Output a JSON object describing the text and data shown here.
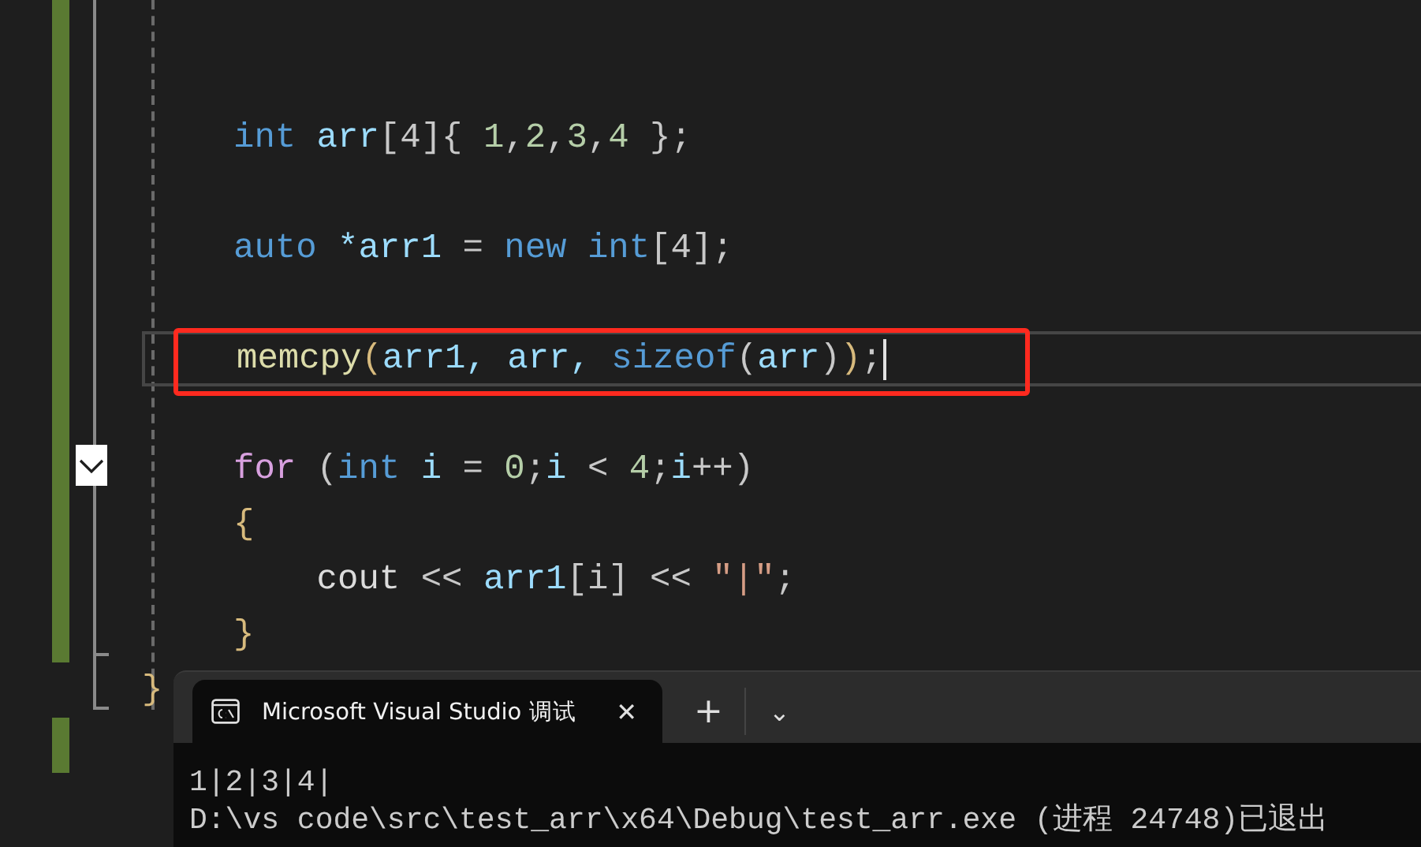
{
  "editor": {
    "lines": [
      {
        "changed": true
      },
      {
        "changed": true
      },
      {
        "changed": true,
        "tokens": [
          {
            "kind": "keyword",
            "text": "int"
          },
          {
            "kind": "ident",
            "text": " arr"
          },
          {
            "kind": "punct",
            "text": "[4]{ "
          },
          {
            "kind": "number",
            "text": "1"
          },
          {
            "kind": "punct",
            "text": ","
          },
          {
            "kind": "number",
            "text": "2"
          },
          {
            "kind": "punct",
            "text": ","
          },
          {
            "kind": "number",
            "text": "3"
          },
          {
            "kind": "punct",
            "text": ","
          },
          {
            "kind": "number",
            "text": "4"
          },
          {
            "kind": "punct",
            "text": " };"
          }
        ]
      },
      {
        "changed": true
      },
      {
        "changed": true,
        "tokens": [
          {
            "kind": "keyword",
            "text": "auto"
          },
          {
            "kind": "ident",
            "text": " *arr1"
          },
          {
            "kind": "punct",
            "text": " = "
          },
          {
            "kind": "keyword",
            "text": "new int"
          },
          {
            "kind": "punct",
            "text": "[4];"
          }
        ]
      },
      {
        "changed": true
      },
      {
        "changed": true,
        "current": true,
        "highlighted": true,
        "tokens": [
          {
            "kind": "func",
            "text": "memcpy"
          },
          {
            "kind": "brace",
            "text": "("
          },
          {
            "kind": "ident",
            "text": "arr1, arr, "
          },
          {
            "kind": "keyword",
            "text": "sizeof"
          },
          {
            "kind": "punct",
            "text": "("
          },
          {
            "kind": "ident",
            "text": "arr"
          },
          {
            "kind": "punct",
            "text": ")"
          },
          {
            "kind": "brace",
            "text": ")"
          },
          {
            "kind": "punct",
            "text": ";"
          }
        ]
      },
      {
        "changed": true
      },
      {
        "changed": true,
        "foldable": true,
        "tokens": [
          {
            "kind": "control",
            "text": "for"
          },
          {
            "kind": "punct",
            "text": " ("
          },
          {
            "kind": "keyword",
            "text": "int"
          },
          {
            "kind": "ident",
            "text": " i"
          },
          {
            "kind": "punct",
            "text": " = "
          },
          {
            "kind": "number",
            "text": "0"
          },
          {
            "kind": "punct",
            "text": ";"
          },
          {
            "kind": "ident",
            "text": "i"
          },
          {
            "kind": "punct",
            "text": " < "
          },
          {
            "kind": "number",
            "text": "4"
          },
          {
            "kind": "punct",
            "text": ";"
          },
          {
            "kind": "ident",
            "text": "i"
          },
          {
            "kind": "punct",
            "text": "++)"
          }
        ]
      },
      {
        "changed": true,
        "tokens": [
          {
            "kind": "brace",
            "text": "{"
          }
        ]
      },
      {
        "changed": true,
        "tokens": [
          {
            "kind": "plain",
            "text": "    cout"
          },
          {
            "kind": "punct",
            "text": " << "
          },
          {
            "kind": "ident",
            "text": "arr1"
          },
          {
            "kind": "punct",
            "text": "[i] << "
          },
          {
            "kind": "string",
            "text": "\"|\""
          },
          {
            "kind": "punct",
            "text": ";"
          }
        ]
      },
      {
        "changed": true,
        "tokens": [
          {
            "kind": "brace",
            "text": "}"
          }
        ]
      },
      {
        "changed": false,
        "outer": true,
        "tokens": [
          {
            "kind": "brace",
            "text": "}"
          }
        ]
      },
      {
        "changed": true
      },
      {
        "changed": false
      }
    ]
  },
  "terminal": {
    "tab": {
      "title": "Microsoft Visual Studio 调试",
      "close": "✕"
    },
    "new_tab": "+",
    "dropdown": "⌄",
    "output": [
      "1|2|3|4|",
      "D:\\vs code\\src\\test_arr\\x64\\Debug\\test_arr.exe (进程 24748)已退出"
    ]
  }
}
